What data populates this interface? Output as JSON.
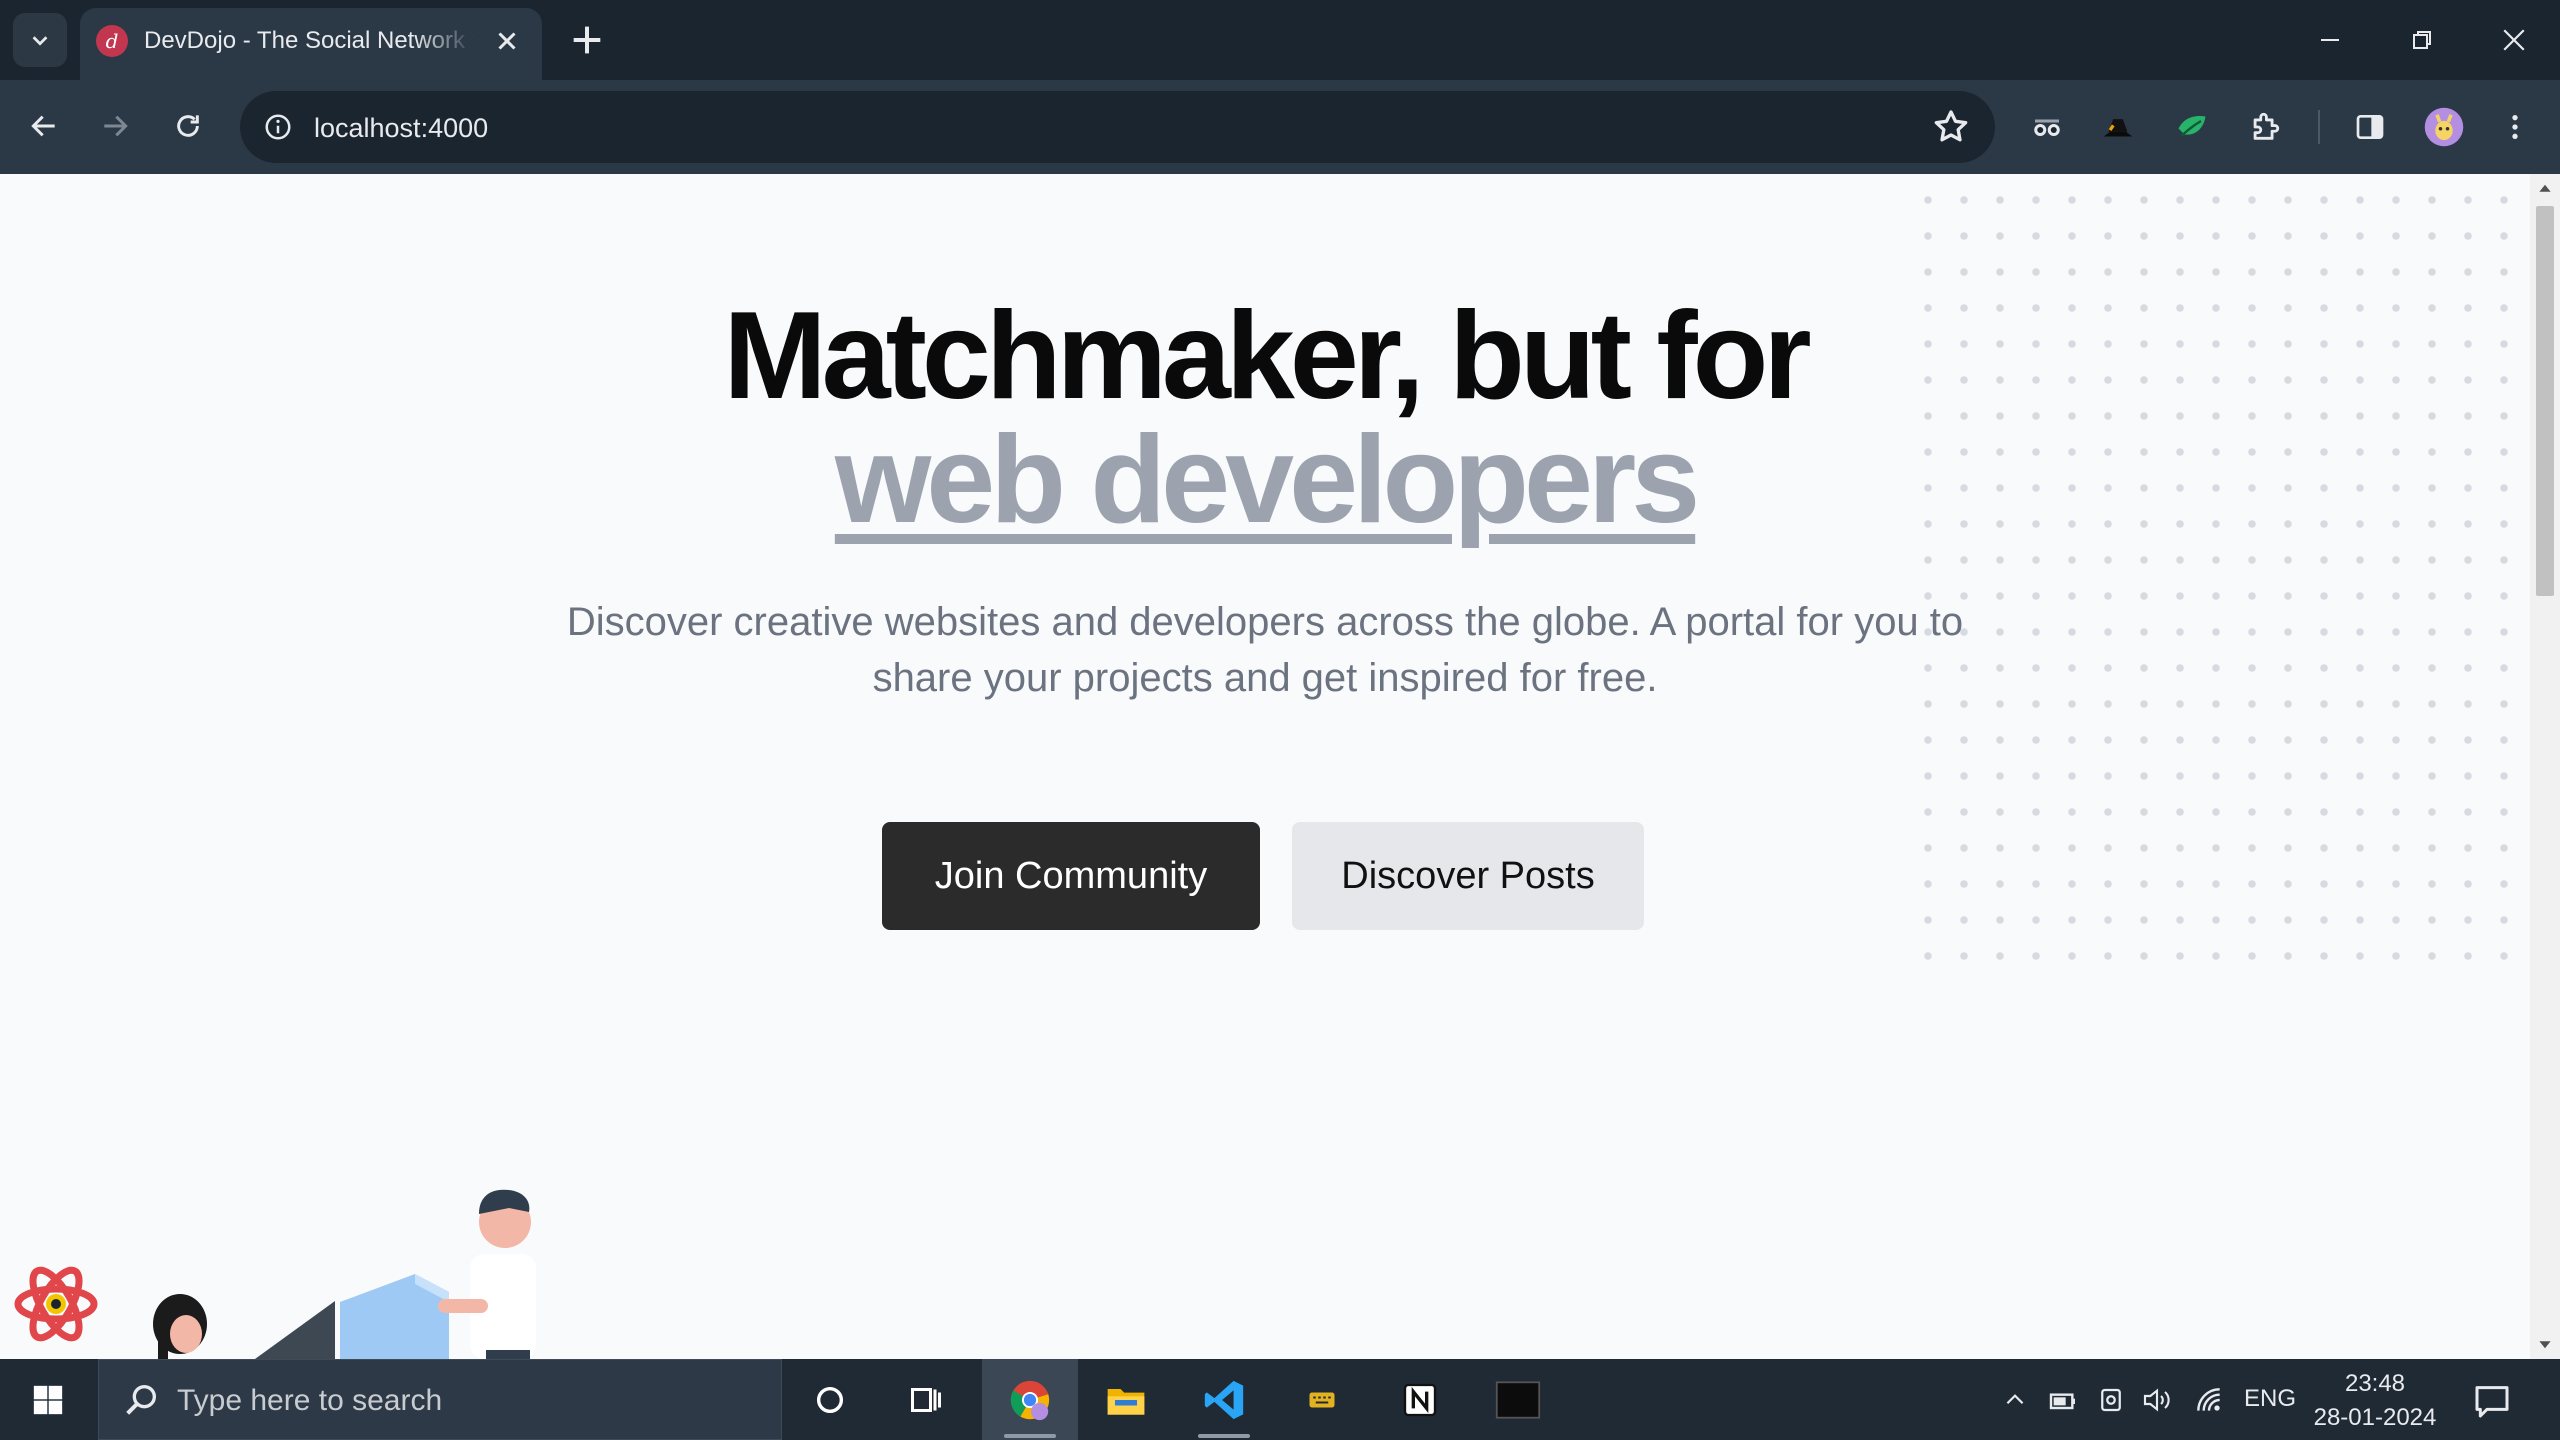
{
  "browser": {
    "tab_title": "DevDojo - The Social Network for Developers",
    "favicon_letter": "d",
    "url": "localhost:4000",
    "icons": [
      "tab-search-icon",
      "close-icon",
      "plus-icon",
      "minimize-icon",
      "restore-icon",
      "window-close-icon",
      "back-icon",
      "forward-icon",
      "reload-icon",
      "site-info-icon",
      "star-icon",
      "extension-glasses-icon",
      "extension-hat-icon",
      "extension-leaf-icon",
      "puzzle-icon",
      "side-panel-icon",
      "profile-avatar",
      "menu-icon"
    ]
  },
  "hero": {
    "headline_line1": "Matchmaker, but for",
    "headline_line2": "web developers",
    "subtitle": "Discover creative websites and developers across the globe. A portal for you to share your projects and get inspired for free.",
    "primary_button": "Join Community",
    "secondary_button": "Discover Posts"
  },
  "taskbar": {
    "search_placeholder": "Type here to search",
    "apps": [
      "cortana",
      "task-view",
      "chrome",
      "file-explorer",
      "vscode",
      "keyboard-app",
      "notion",
      "terminal"
    ],
    "language": "ENG",
    "time": "23:48",
    "date": "28-01-2024"
  },
  "colors": {
    "chrome_dark": "#1a2530",
    "chrome_toolbar": "#2b3947",
    "page_bg": "#f9fafb",
    "headline_accent": "#9ca3af",
    "primary_button": "#2b2b2b",
    "secondary_button": "#e5e7eb"
  }
}
